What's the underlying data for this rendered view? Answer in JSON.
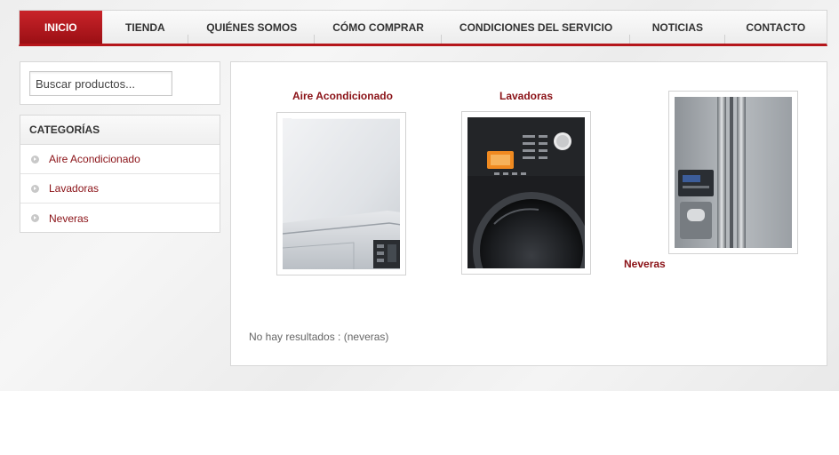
{
  "nav": {
    "items": [
      {
        "label": "INICIO",
        "active": true
      },
      {
        "label": "TIENDA"
      },
      {
        "label": "QUIÉNES SOMOS"
      },
      {
        "label": "CÓMO COMPRAR"
      },
      {
        "label": "CONDICIONES DEL SERVICIO"
      },
      {
        "label": "NOTICIAS"
      },
      {
        "label": "CONTACTO"
      }
    ]
  },
  "search": {
    "placeholder": "Buscar productos..."
  },
  "categories": {
    "header": "CATEGORÍAS",
    "items": [
      {
        "label": "Aire Acondicionado"
      },
      {
        "label": "Lavadoras"
      },
      {
        "label": "Neveras"
      }
    ]
  },
  "products": [
    {
      "name": "Aire Acondicionado",
      "icon": "air-conditioner-image"
    },
    {
      "name": "Lavadoras",
      "icon": "washing-machine-image"
    },
    {
      "name": "Neveras",
      "icon": "refrigerator-image"
    }
  ],
  "results": {
    "message": "No hay resultados : (neveras)"
  },
  "colors": {
    "accent": "#b5161b",
    "link": "#8a1116"
  }
}
